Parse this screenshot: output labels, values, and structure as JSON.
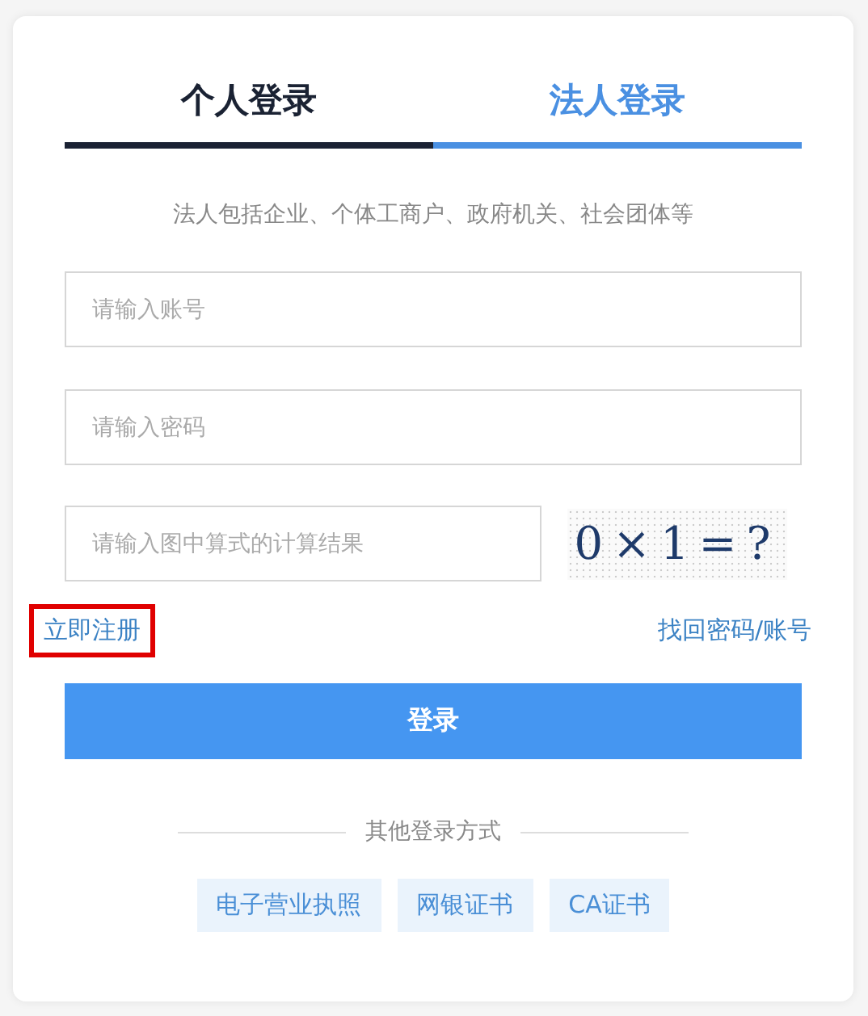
{
  "tabs": [
    {
      "label": "个人登录",
      "selected": false
    },
    {
      "label": "法人登录",
      "selected": true
    }
  ],
  "subtitle": "法人包括企业、个体工商户、政府机关、社会团体等",
  "fields": [
    {
      "placeholder": "请输入账号"
    },
    {
      "placeholder": "请输入密码"
    }
  ],
  "captcha": {
    "placeholder": "请输入图中算式的计算结果",
    "image_text": "0×1=?"
  },
  "links": {
    "register": {
      "label": "立即注册",
      "highlighted": true
    },
    "recover": {
      "label": "找回密码/账号"
    }
  },
  "login_button": "登录",
  "other_methods": {
    "title": "其他登录方式",
    "options": [
      "电子营业执照",
      "网银证书",
      "CA证书"
    ]
  }
}
